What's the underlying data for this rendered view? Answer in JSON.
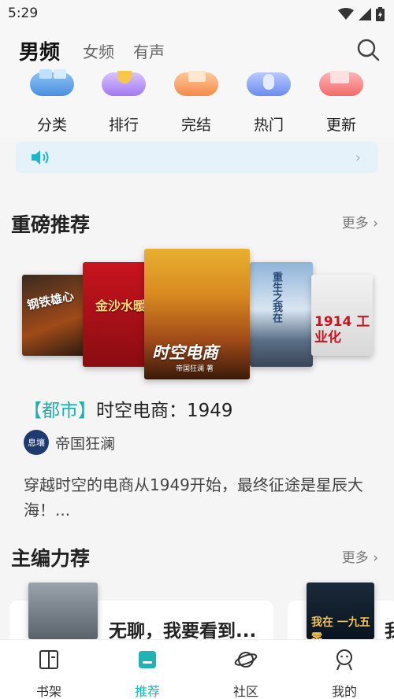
{
  "status": {
    "time": "5:29"
  },
  "nav": {
    "tabs": [
      "男频",
      "女频",
      "有声"
    ]
  },
  "categories": [
    "分类",
    "排行",
    "完结",
    "热门",
    "更新"
  ],
  "section1": {
    "title": "重磅推荐",
    "more": "更多 ›"
  },
  "featured": {
    "tag": "【都市】",
    "title": "时空电商：1949",
    "author_badge": "息壤",
    "author": "帝国狂澜",
    "description": "穿越时空的电商从1949开始，最终征途是星辰大海！..."
  },
  "covers": {
    "c1": "钢铁雄心",
    "c2": "金沙水暖",
    "c3": "时空电商",
    "c3_author": "帝国狂澜 著",
    "c4": "重生之我在",
    "c5": "1914 工业化"
  },
  "section2": {
    "title": "主编力荐",
    "more": "更多 ›"
  },
  "cards": {
    "first_title": "无聊，我要看到...",
    "second_cover_text": "我在 一九五零",
    "second_title_char": "我"
  },
  "bottom": {
    "items": [
      "书架",
      "推荐",
      "社区",
      "我的"
    ]
  },
  "colors": {
    "accent": "#1fb3b3"
  }
}
